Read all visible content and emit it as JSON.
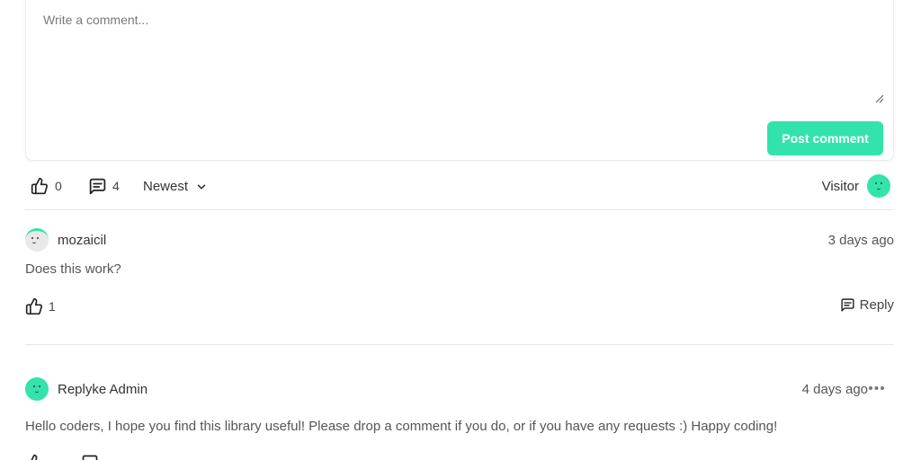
{
  "composer": {
    "placeholder": "Write a comment...",
    "value": "",
    "post_label": "Post comment"
  },
  "toolbar": {
    "likes_count": "0",
    "comments_count": "4",
    "sort_label": "Newest",
    "user_label": "Visitor"
  },
  "comments": [
    {
      "author": "mozaicil",
      "time": "3 days ago",
      "body": "Does this work?",
      "likes": "1",
      "reply_label": "Reply",
      "avatar": "grey-face-avatar"
    },
    {
      "author": "Replyke Admin",
      "time": "4 days ago",
      "body": "Hello coders, I hope you find this library useful! Please drop a comment if you do, or if you have any requests :) Happy coding!",
      "avatar": "green-face-avatar"
    }
  ],
  "colors": {
    "accent": "#33e3ac",
    "divider": "#e7e7e7",
    "text": "#333333"
  },
  "icons": {
    "like": "thumbs-up-icon",
    "comments": "message-square-icon",
    "sort": "chevron-down-icon",
    "reply": "message-square-icon",
    "menu": "more-horizontal-icon"
  }
}
